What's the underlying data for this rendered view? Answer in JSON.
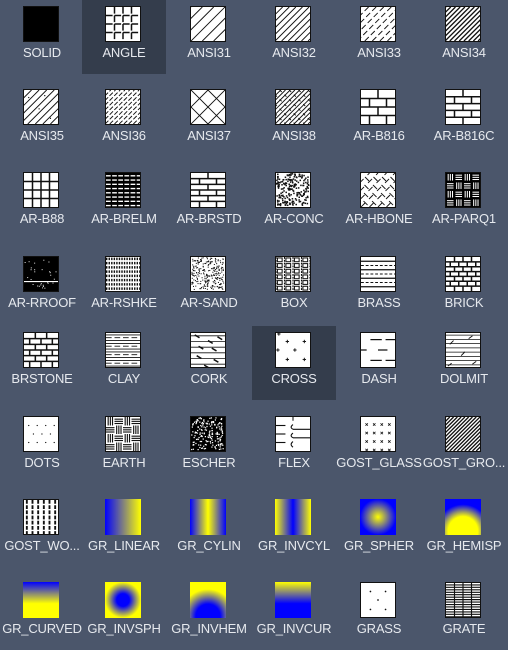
{
  "palette": {
    "background": "#4b566b",
    "selected_background": "#343d4c",
    "gradient_color_1": "#0000ff",
    "gradient_color_2": "#ffff00"
  },
  "selected": [
    "ANGLE",
    "CROSS"
  ],
  "patterns": [
    {
      "name": "SOLID",
      "icon": "solid-pattern-icon"
    },
    {
      "name": "ANGLE",
      "icon": "angle-pattern-icon"
    },
    {
      "name": "ANSI31",
      "icon": "ansi31-pattern-icon"
    },
    {
      "name": "ANSI32",
      "icon": "ansi32-pattern-icon"
    },
    {
      "name": "ANSI33",
      "icon": "ansi33-pattern-icon"
    },
    {
      "name": "ANSI34",
      "icon": "ansi34-pattern-icon"
    },
    {
      "name": "ANSI35",
      "icon": "ansi35-pattern-icon"
    },
    {
      "name": "ANSI36",
      "icon": "ansi36-pattern-icon"
    },
    {
      "name": "ANSI37",
      "icon": "ansi37-pattern-icon"
    },
    {
      "name": "ANSI38",
      "icon": "ansi38-pattern-icon"
    },
    {
      "name": "AR-B816",
      "icon": "ar-b816-pattern-icon"
    },
    {
      "name": "AR-B816C",
      "icon": "ar-b816c-pattern-icon"
    },
    {
      "name": "AR-B88",
      "icon": "ar-b88-pattern-icon"
    },
    {
      "name": "AR-BRELM",
      "icon": "ar-brelm-pattern-icon"
    },
    {
      "name": "AR-BRSTD",
      "icon": "ar-brstd-pattern-icon"
    },
    {
      "name": "AR-CONC",
      "icon": "ar-conc-pattern-icon"
    },
    {
      "name": "AR-HBONE",
      "icon": "ar-hbone-pattern-icon"
    },
    {
      "name": "AR-PARQ1",
      "icon": "ar-parq1-pattern-icon"
    },
    {
      "name": "AR-RROOF",
      "icon": "ar-rroof-pattern-icon"
    },
    {
      "name": "AR-RSHKE",
      "icon": "ar-rshke-pattern-icon"
    },
    {
      "name": "AR-SAND",
      "icon": "ar-sand-pattern-icon"
    },
    {
      "name": "BOX",
      "icon": "box-pattern-icon"
    },
    {
      "name": "BRASS",
      "icon": "brass-pattern-icon"
    },
    {
      "name": "BRICK",
      "icon": "brick-pattern-icon"
    },
    {
      "name": "BRSTONE",
      "icon": "brstone-pattern-icon"
    },
    {
      "name": "CLAY",
      "icon": "clay-pattern-icon"
    },
    {
      "name": "CORK",
      "icon": "cork-pattern-icon"
    },
    {
      "name": "CROSS",
      "icon": "cross-pattern-icon"
    },
    {
      "name": "DASH",
      "icon": "dash-pattern-icon"
    },
    {
      "name": "DOLMIT",
      "icon": "dolmit-pattern-icon"
    },
    {
      "name": "DOTS",
      "icon": "dots-pattern-icon"
    },
    {
      "name": "EARTH",
      "icon": "earth-pattern-icon"
    },
    {
      "name": "ESCHER",
      "icon": "escher-pattern-icon"
    },
    {
      "name": "FLEX",
      "icon": "flex-pattern-icon"
    },
    {
      "name": "GOST_GLASS",
      "icon": "gost-glass-pattern-icon"
    },
    {
      "name": "GOST_GRO...",
      "icon": "gost-ground-pattern-icon"
    },
    {
      "name": "GOST_WO...",
      "icon": "gost-wood-pattern-icon"
    },
    {
      "name": "GR_LINEAR",
      "icon": "gradient-linear-icon"
    },
    {
      "name": "GR_CYLIN",
      "icon": "gradient-cylinder-icon"
    },
    {
      "name": "GR_INVCYL",
      "icon": "gradient-inverted-cylinder-icon"
    },
    {
      "name": "GR_SPHER",
      "icon": "gradient-spherical-icon"
    },
    {
      "name": "GR_HEMISP",
      "icon": "gradient-hemispherical-icon"
    },
    {
      "name": "GR_CURVED",
      "icon": "gradient-curved-icon"
    },
    {
      "name": "GR_INVSPH",
      "icon": "gradient-inverted-spherical-icon"
    },
    {
      "name": "GR_INVHEM",
      "icon": "gradient-inverted-hemispherical-icon"
    },
    {
      "name": "GR_INVCUR",
      "icon": "gradient-inverted-curved-icon"
    },
    {
      "name": "GRASS",
      "icon": "grass-pattern-icon"
    },
    {
      "name": "GRATE",
      "icon": "grate-pattern-icon"
    }
  ]
}
